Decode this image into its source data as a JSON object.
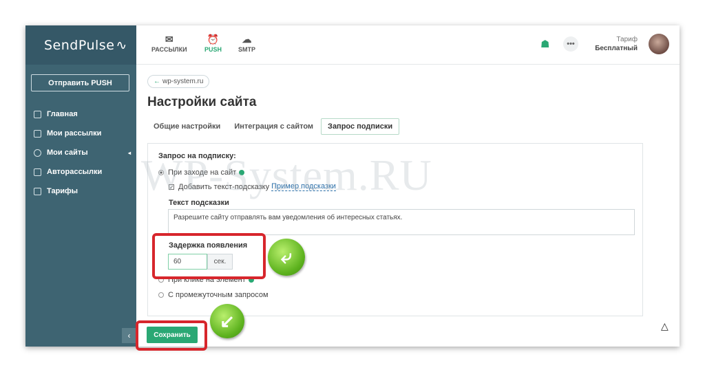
{
  "brand": {
    "name": "SendPulse",
    "pulse": "∿"
  },
  "sidebar": {
    "push_button": "Отправить PUSH",
    "items": [
      {
        "label": "Главная",
        "icon": "home-icon"
      },
      {
        "label": "Мои рассылки",
        "icon": "mail-list-icon"
      },
      {
        "label": "Мои сайты",
        "icon": "globe-icon",
        "arrow": "◂"
      },
      {
        "label": "Авторассылки",
        "icon": "auto-icon"
      },
      {
        "label": "Тарифы",
        "icon": "tariff-icon"
      }
    ],
    "collapse": "‹"
  },
  "topbar": {
    "tabs": [
      {
        "label": "РАССЫЛКИ",
        "icon": "✉",
        "active": false
      },
      {
        "label": "PUSH",
        "icon": "⏰",
        "active": true
      },
      {
        "label": "SMTP",
        "icon": "☁",
        "active": false
      }
    ],
    "gift_icon": "☗",
    "more": "•••",
    "tariff_label": "Тариф",
    "tariff_value": "Бесплатный"
  },
  "breadcrumb": {
    "arrow": "←",
    "text": "wp-system.ru"
  },
  "page_title": "Настройки сайта",
  "tabs": [
    {
      "label": "Общие настройки",
      "active": false
    },
    {
      "label": "Интеграция с сайтом",
      "active": false
    },
    {
      "label": "Запрос подписки",
      "active": true
    }
  ],
  "form": {
    "section_title": "Запрос на подписку:",
    "option_visit": "При заходе на сайт",
    "add_hint_label": "Добавить текст-подсказку",
    "hint_example_link": "Пример подсказки",
    "hint_text_label": "Текст подсказки",
    "hint_text_value": "Разрешите сайту  отправлять вам уведомления об интересных статьях.",
    "delay_label": "Задержка появления",
    "delay_value": "60",
    "delay_unit": "сек.",
    "option_click": "При клике на элемент",
    "option_interval": "С промежуточным запросом",
    "check_mark": "✓"
  },
  "save_button": "Сохранить",
  "watermark": "WP-System.RU",
  "arrow_glyph": "⤶",
  "arrow_glyph2": "↙",
  "cursor": "△",
  "colors": {
    "sidebar": "#3e6472",
    "accent": "#2aa874",
    "highlight": "#d7262c"
  }
}
